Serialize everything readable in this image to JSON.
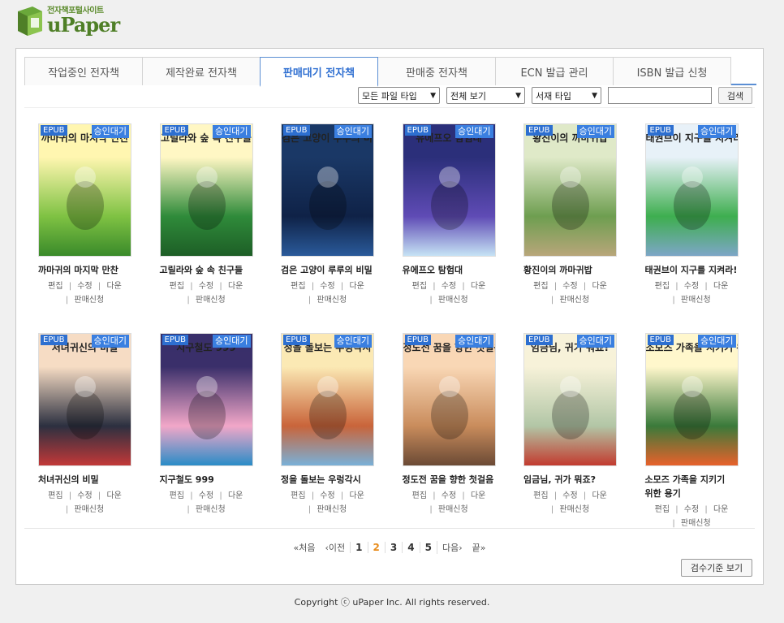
{
  "logo": {
    "subtitle": "전자책포털사이트",
    "brand": "uPaper"
  },
  "tabs": [
    {
      "label": "작업중인 전자책"
    },
    {
      "label": "제작완료 전자책"
    },
    {
      "label": "판매대기 전자책"
    },
    {
      "label": "판매중 전자책"
    },
    {
      "label": "ECN 발급 관리"
    },
    {
      "label": "ISBN 발급 신청"
    }
  ],
  "filters": {
    "file_type": "모든 파일 타입",
    "view": "전체 보기",
    "shelf_type": "서재 타입",
    "search_placeholder": "",
    "search_label": "검색"
  },
  "book_common": {
    "format": "EPUB",
    "status": "승인대기",
    "edit": "편집",
    "modify": "수정",
    "download": "다운",
    "sale_request": "판매신청",
    "sep": "|"
  },
  "books": [
    {
      "title": "까마귀의 마지막 만찬",
      "cover_title": "까마귀의 마지막 만찬"
    },
    {
      "title": "고릴라와 숲 속 친구들",
      "cover_title": "고릴라와 숲 속 친구들"
    },
    {
      "title": "검은 고양이 루루의 비밀",
      "cover_title": "검은 고양이 루루의 비밀"
    },
    {
      "title": "유에프오 탐험대",
      "cover_title": "유에프오 탐험대"
    },
    {
      "title": "황진이의 까마귀밥",
      "cover_title": "황진이의 까마귀밥"
    },
    {
      "title": "태권브이 지구를 지켜라!",
      "cover_title": "태권브이 지구를 지켜라!"
    },
    {
      "title": "처녀귀신의 비밀",
      "cover_title": "처녀귀신의 비밀"
    },
    {
      "title": "지구철도 999",
      "cover_title": "지구철도 999"
    },
    {
      "title": "정을 돌보는 우렁각시",
      "cover_title": "정을 돌보는 우렁각시"
    },
    {
      "title": "정도전 꿈을 향한 첫걸음",
      "cover_title": "정도전 꿈을 향한 첫걸음"
    },
    {
      "title": "임금님, 귀가 뭐죠?",
      "cover_title": "임금님, 귀가 뭐죠?"
    },
    {
      "title": "소모즈 가족을 지키기 위한 용기",
      "cover_title": "소모즈 가족을 지키기 위한 용기"
    }
  ],
  "pager": {
    "first": "처음",
    "prev": "이전",
    "pages": [
      "1",
      "2",
      "3",
      "4",
      "5"
    ],
    "current": "2",
    "next": "다음",
    "last": "끝"
  },
  "guide_button": "검수기준 보기",
  "footer": "Copyright ⓒ uPaper Inc. All rights reserved.",
  "colors": {
    "accent": "#2f6fd1",
    "brand": "#4f7f27",
    "current_page": "#e88b1a"
  }
}
